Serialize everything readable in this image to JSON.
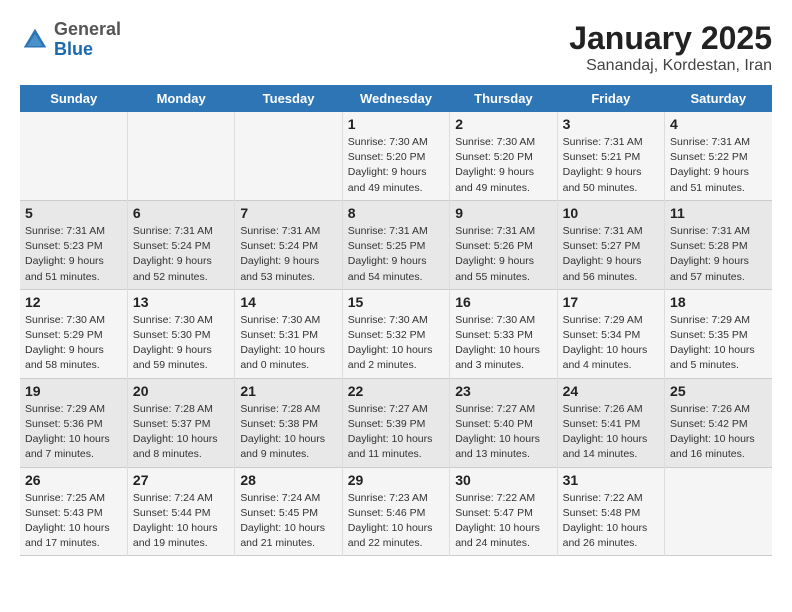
{
  "logo": {
    "general": "General",
    "blue": "Blue"
  },
  "title": "January 2025",
  "subtitle": "Sanandaj, Kordestan, Iran",
  "days_of_week": [
    "Sunday",
    "Monday",
    "Tuesday",
    "Wednesday",
    "Thursday",
    "Friday",
    "Saturday"
  ],
  "weeks": [
    [
      {
        "day": "",
        "info": ""
      },
      {
        "day": "",
        "info": ""
      },
      {
        "day": "",
        "info": ""
      },
      {
        "day": "1",
        "info": "Sunrise: 7:30 AM\nSunset: 5:20 PM\nDaylight: 9 hours and 49 minutes."
      },
      {
        "day": "2",
        "info": "Sunrise: 7:30 AM\nSunset: 5:20 PM\nDaylight: 9 hours and 49 minutes."
      },
      {
        "day": "3",
        "info": "Sunrise: 7:31 AM\nSunset: 5:21 PM\nDaylight: 9 hours and 50 minutes."
      },
      {
        "day": "4",
        "info": "Sunrise: 7:31 AM\nSunset: 5:22 PM\nDaylight: 9 hours and 51 minutes."
      }
    ],
    [
      {
        "day": "5",
        "info": "Sunrise: 7:31 AM\nSunset: 5:23 PM\nDaylight: 9 hours and 51 minutes."
      },
      {
        "day": "6",
        "info": "Sunrise: 7:31 AM\nSunset: 5:24 PM\nDaylight: 9 hours and 52 minutes."
      },
      {
        "day": "7",
        "info": "Sunrise: 7:31 AM\nSunset: 5:24 PM\nDaylight: 9 hours and 53 minutes."
      },
      {
        "day": "8",
        "info": "Sunrise: 7:31 AM\nSunset: 5:25 PM\nDaylight: 9 hours and 54 minutes."
      },
      {
        "day": "9",
        "info": "Sunrise: 7:31 AM\nSunset: 5:26 PM\nDaylight: 9 hours and 55 minutes."
      },
      {
        "day": "10",
        "info": "Sunrise: 7:31 AM\nSunset: 5:27 PM\nDaylight: 9 hours and 56 minutes."
      },
      {
        "day": "11",
        "info": "Sunrise: 7:31 AM\nSunset: 5:28 PM\nDaylight: 9 hours and 57 minutes."
      }
    ],
    [
      {
        "day": "12",
        "info": "Sunrise: 7:30 AM\nSunset: 5:29 PM\nDaylight: 9 hours and 58 minutes."
      },
      {
        "day": "13",
        "info": "Sunrise: 7:30 AM\nSunset: 5:30 PM\nDaylight: 9 hours and 59 minutes."
      },
      {
        "day": "14",
        "info": "Sunrise: 7:30 AM\nSunset: 5:31 PM\nDaylight: 10 hours and 0 minutes."
      },
      {
        "day": "15",
        "info": "Sunrise: 7:30 AM\nSunset: 5:32 PM\nDaylight: 10 hours and 2 minutes."
      },
      {
        "day": "16",
        "info": "Sunrise: 7:30 AM\nSunset: 5:33 PM\nDaylight: 10 hours and 3 minutes."
      },
      {
        "day": "17",
        "info": "Sunrise: 7:29 AM\nSunset: 5:34 PM\nDaylight: 10 hours and 4 minutes."
      },
      {
        "day": "18",
        "info": "Sunrise: 7:29 AM\nSunset: 5:35 PM\nDaylight: 10 hours and 5 minutes."
      }
    ],
    [
      {
        "day": "19",
        "info": "Sunrise: 7:29 AM\nSunset: 5:36 PM\nDaylight: 10 hours and 7 minutes."
      },
      {
        "day": "20",
        "info": "Sunrise: 7:28 AM\nSunset: 5:37 PM\nDaylight: 10 hours and 8 minutes."
      },
      {
        "day": "21",
        "info": "Sunrise: 7:28 AM\nSunset: 5:38 PM\nDaylight: 10 hours and 9 minutes."
      },
      {
        "day": "22",
        "info": "Sunrise: 7:27 AM\nSunset: 5:39 PM\nDaylight: 10 hours and 11 minutes."
      },
      {
        "day": "23",
        "info": "Sunrise: 7:27 AM\nSunset: 5:40 PM\nDaylight: 10 hours and 13 minutes."
      },
      {
        "day": "24",
        "info": "Sunrise: 7:26 AM\nSunset: 5:41 PM\nDaylight: 10 hours and 14 minutes."
      },
      {
        "day": "25",
        "info": "Sunrise: 7:26 AM\nSunset: 5:42 PM\nDaylight: 10 hours and 16 minutes."
      }
    ],
    [
      {
        "day": "26",
        "info": "Sunrise: 7:25 AM\nSunset: 5:43 PM\nDaylight: 10 hours and 17 minutes."
      },
      {
        "day": "27",
        "info": "Sunrise: 7:24 AM\nSunset: 5:44 PM\nDaylight: 10 hours and 19 minutes."
      },
      {
        "day": "28",
        "info": "Sunrise: 7:24 AM\nSunset: 5:45 PM\nDaylight: 10 hours and 21 minutes."
      },
      {
        "day": "29",
        "info": "Sunrise: 7:23 AM\nSunset: 5:46 PM\nDaylight: 10 hours and 22 minutes."
      },
      {
        "day": "30",
        "info": "Sunrise: 7:22 AM\nSunset: 5:47 PM\nDaylight: 10 hours and 24 minutes."
      },
      {
        "day": "31",
        "info": "Sunrise: 7:22 AM\nSunset: 5:48 PM\nDaylight: 10 hours and 26 minutes."
      },
      {
        "day": "",
        "info": ""
      }
    ]
  ]
}
